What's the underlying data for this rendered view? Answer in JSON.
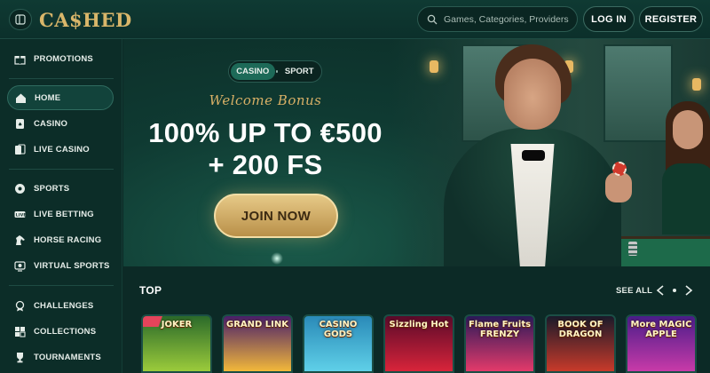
{
  "header": {
    "logo": "CA$HED",
    "search_placeholder": "Games, Categories, Providers",
    "login_label": "LOG IN",
    "register_label": "REGISTER"
  },
  "sidebar": {
    "items": [
      {
        "label": "PROMOTIONS",
        "icon": "gift-icon"
      },
      {
        "label": "HOME",
        "icon": "home-icon",
        "active": true
      },
      {
        "label": "CASINO",
        "icon": "cards-icon"
      },
      {
        "label": "LIVE CASINO",
        "icon": "live-cards-icon"
      },
      {
        "label": "SPORTS",
        "icon": "ball-icon"
      },
      {
        "label": "LIVE BETTING",
        "icon": "live-icon"
      },
      {
        "label": "HORSE RACING",
        "icon": "horse-icon"
      },
      {
        "label": "VIRTUAL SPORTS",
        "icon": "virtual-icon"
      },
      {
        "label": "CHALLENGES",
        "icon": "medal-icon"
      },
      {
        "label": "COLLECTIONS",
        "icon": "collection-icon"
      },
      {
        "label": "TOURNAMENTS",
        "icon": "trophy-icon"
      }
    ]
  },
  "hero": {
    "toggle_casino": "CASINO",
    "toggle_sport": "SPORT",
    "welcome": "Welcome Bonus",
    "headline_line1": "100% UP TO €500",
    "headline_line2": "+ 200 FS",
    "cta": "JOIN NOW"
  },
  "top_section": {
    "title": "TOP",
    "see_all": "SEE ALL",
    "games": [
      {
        "label": "JOKER",
        "colors": [
          "#2b6a2a",
          "#9bcb3b"
        ]
      },
      {
        "label": "GRAND LINK",
        "colors": [
          "#4a1f6a",
          "#f2b83a"
        ]
      },
      {
        "label": "CASINO GODS",
        "colors": [
          "#2a8ab8",
          "#5fd0e8"
        ]
      },
      {
        "label": "Sizzling Hot",
        "colors": [
          "#5a0a2a",
          "#d8243a"
        ]
      },
      {
        "label": "Flame Fruits FRENZY",
        "colors": [
          "#2b1a5a",
          "#e33a6a"
        ]
      },
      {
        "label": "BOOK OF DRAGON",
        "colors": [
          "#1a1a2a",
          "#c83a2a"
        ]
      },
      {
        "label": "More MAGIC APPLE",
        "colors": [
          "#4a1d8a",
          "#c83aa8"
        ]
      }
    ]
  },
  "colors": {
    "accent_gold": "#d9b66a",
    "bg": "#0c2a26",
    "active": "#12433b"
  }
}
